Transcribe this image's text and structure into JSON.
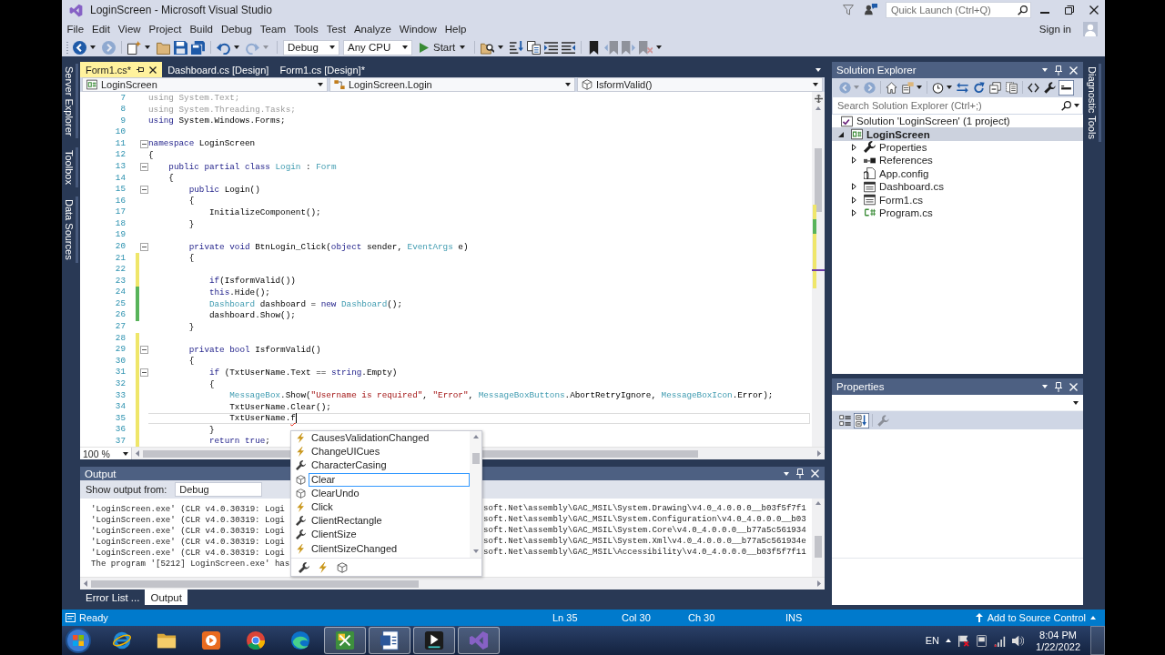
{
  "window": {
    "title": "LoginScreen - Microsoft Visual Studio",
    "quick_launch": {
      "placeholder": "Quick Launch (Ctrl+Q)"
    }
  },
  "menu": {
    "items": [
      "File",
      "Edit",
      "View",
      "Project",
      "Build",
      "Debug",
      "Team",
      "Tools",
      "Test",
      "Analyze",
      "Window",
      "Help"
    ],
    "sign_in": "Sign in"
  },
  "toolbar": {
    "left": [
      {
        "kind": "back",
        "disabled": false
      },
      {
        "kind": "forward",
        "disabled": true
      },
      {
        "kind": "new_project",
        "disabled": false
      },
      {
        "kind": "open",
        "disabled": false
      },
      {
        "kind": "save",
        "disabled": false
      },
      {
        "kind": "save_all",
        "disabled": false
      },
      {
        "kind": "undo",
        "disabled": false
      },
      {
        "kind": "redo",
        "disabled": true
      }
    ],
    "configuration": "Debug",
    "platform": "Any CPU",
    "start": "Start",
    "right": [
      {
        "kind": "find",
        "disabled": false
      },
      {
        "kind": "step",
        "disabled": false
      },
      {
        "kind": "pages",
        "disabled": false
      },
      {
        "kind": "comment",
        "disabled": false
      },
      {
        "kind": "uncomment",
        "disabled": false
      },
      {
        "kind": "bookmark",
        "disabled": false
      },
      {
        "kind": "bookmark_prev",
        "disabled": true
      },
      {
        "kind": "bookmark_next",
        "disabled": true
      },
      {
        "kind": "bookmark_clear",
        "disabled": true
      }
    ]
  },
  "side_tabs_left": [
    "Server Explorer",
    "Toolbox",
    "Data Sources"
  ],
  "document_tabs": [
    {
      "label": "Form1.cs*",
      "selected": true
    },
    {
      "label": "Dashboard.cs [Design]",
      "selected": false
    },
    {
      "label": "Form1.cs [Design]*",
      "selected": false
    }
  ],
  "navigation_bar": {
    "project": "LoginScreen",
    "type": "LoginScreen.Login",
    "member": "IsformValid()"
  },
  "editor": {
    "lines": [
      {
        "number": "7",
        "fold": false,
        "current": false,
        "tokens": [
          {
            "kind": "dim",
            "text": "using System.Text;"
          }
        ]
      },
      {
        "number": "8",
        "fold": false,
        "current": false,
        "tokens": [
          {
            "kind": "dim",
            "text": "using System.Threading.Tasks;"
          }
        ]
      },
      {
        "number": "9",
        "fold": false,
        "current": false,
        "tokens": [
          {
            "kind": "keyword",
            "text": "using"
          },
          {
            "kind": "plain",
            "text": " System.Windows.Forms;"
          }
        ]
      },
      {
        "number": "10",
        "fold": false,
        "current": false
      },
      {
        "number": "11",
        "fold": true,
        "current": false,
        "tokens": [
          {
            "kind": "keyword",
            "text": "namespace"
          },
          {
            "kind": "plain",
            "text": " LoginScreen"
          }
        ]
      },
      {
        "number": "12",
        "fold": false,
        "current": false,
        "tokens": [
          {
            "kind": "plain",
            "text": "{"
          }
        ]
      },
      {
        "number": "13",
        "fold": true,
        "current": false,
        "tokens": [
          {
            "kind": "keyword",
            "text": "    public partial class"
          },
          {
            "kind": "type",
            "text": " Login"
          },
          {
            "kind": "plain",
            "text": " : "
          },
          {
            "kind": "type",
            "text": "Form"
          }
        ]
      },
      {
        "number": "14",
        "fold": false,
        "current": false,
        "tokens": [
          {
            "kind": "plain",
            "text": "    {"
          }
        ]
      },
      {
        "number": "15",
        "fold": true,
        "current": false,
        "tokens": [
          {
            "kind": "keyword",
            "text": "        public"
          },
          {
            "kind": "plain",
            "text": " Login()"
          }
        ]
      },
      {
        "number": "16",
        "fold": false,
        "current": false,
        "tokens": [
          {
            "kind": "plain",
            "text": "        {"
          }
        ]
      },
      {
        "number": "17",
        "fold": false,
        "current": false,
        "tokens": [
          {
            "kind": "plain",
            "text": "            InitializeComponent();"
          }
        ]
      },
      {
        "number": "18",
        "fold": false,
        "current": false,
        "tokens": [
          {
            "kind": "plain",
            "text": "        }"
          }
        ]
      },
      {
        "number": "19",
        "fold": false,
        "current": false
      },
      {
        "number": "20",
        "fold": true,
        "current": false,
        "tokens": [
          {
            "kind": "keyword",
            "text": "        private void"
          },
          {
            "kind": "plain",
            "text": " BtnLogin_Click("
          },
          {
            "kind": "keyword",
            "text": "object"
          },
          {
            "kind": "plain",
            "text": " sender, "
          },
          {
            "kind": "type",
            "text": "EventArgs"
          },
          {
            "kind": "plain",
            "text": " e)"
          }
        ]
      },
      {
        "number": "21",
        "color": "#efe66a",
        "fold": false,
        "current": false,
        "tokens": [
          {
            "kind": "plain",
            "text": "        {"
          }
        ]
      },
      {
        "number": "22",
        "color": "#efe66a",
        "fold": false,
        "current": false
      },
      {
        "number": "23",
        "color": "#efe66a",
        "fold": false,
        "current": false,
        "tokens": [
          {
            "kind": "keyword",
            "text": "            if"
          },
          {
            "kind": "plain",
            "text": "(IsformValid())"
          }
        ]
      },
      {
        "number": "24",
        "color": "#58b35a",
        "fold": false,
        "current": false,
        "tokens": [
          {
            "kind": "keyword",
            "text": "            this"
          },
          {
            "kind": "plain",
            "text": ".Hide();"
          }
        ]
      },
      {
        "number": "25",
        "color": "#58b35a",
        "fold": false,
        "current": false,
        "tokens": [
          {
            "kind": "type",
            "text": "            Dashboard"
          },
          {
            "kind": "plain",
            "text": " dashboard = "
          },
          {
            "kind": "keyword",
            "text": "new"
          },
          {
            "kind": "type",
            "text": " Dashboard"
          },
          {
            "kind": "plain",
            "text": "();"
          }
        ]
      },
      {
        "number": "26",
        "color": "#58b35a",
        "fold": false,
        "current": false,
        "tokens": [
          {
            "kind": "plain",
            "text": "            dashboard.Show();"
          }
        ]
      },
      {
        "number": "27",
        "fold": false,
        "current": false,
        "tokens": [
          {
            "kind": "plain",
            "text": "        }"
          }
        ]
      },
      {
        "number": "28",
        "color": "#efe66a",
        "fold": false,
        "current": false
      },
      {
        "number": "29",
        "color": "#efe66a",
        "fold": true,
        "current": false,
        "tokens": [
          {
            "kind": "keyword",
            "text": "        private bool"
          },
          {
            "kind": "plain",
            "text": " IsformValid()"
          }
        ]
      },
      {
        "number": "30",
        "color": "#efe66a",
        "fold": false,
        "current": false,
        "tokens": [
          {
            "kind": "plain",
            "text": "        {"
          }
        ]
      },
      {
        "number": "31",
        "color": "#efe66a",
        "fold": true,
        "current": false,
        "tokens": [
          {
            "kind": "keyword",
            "text": "            if"
          },
          {
            "kind": "plain",
            "text": " (TxtUserName.Text == "
          },
          {
            "kind": "keyword",
            "text": "string"
          },
          {
            "kind": "plain",
            "text": ".Empty)"
          }
        ]
      },
      {
        "number": "32",
        "color": "#efe66a",
        "fold": false,
        "current": false,
        "tokens": [
          {
            "kind": "plain",
            "text": "            {"
          }
        ]
      },
      {
        "number": "33",
        "color": "#efe66a",
        "fold": false,
        "current": false,
        "tokens": [
          {
            "kind": "type",
            "text": "                MessageBox"
          },
          {
            "kind": "plain",
            "text": ".Show("
          },
          {
            "kind": "string",
            "text": "\"Username is required\""
          },
          {
            "kind": "plain",
            "text": ", "
          },
          {
            "kind": "string",
            "text": "\"Error\""
          },
          {
            "kind": "plain",
            "text": ", "
          },
          {
            "kind": "type",
            "text": "MessageBoxButtons"
          },
          {
            "kind": "plain",
            "text": ".AbortRetryIgnore, "
          },
          {
            "kind": "type",
            "text": "MessageBoxIcon"
          },
          {
            "kind": "plain",
            "text": ".Error);"
          }
        ]
      },
      {
        "number": "34",
        "color": "#efe66a",
        "fold": false,
        "current": false,
        "tokens": [
          {
            "kind": "plain",
            "text": "                TxtUserName.Clear();"
          }
        ]
      },
      {
        "number": "35",
        "color": "#efe66a",
        "fold": false,
        "current": true,
        "tokens": [
          {
            "kind": "plain",
            "text": "                TxtUserName."
          },
          {
            "kind": "error",
            "text": "f"
          }
        ]
      },
      {
        "number": "36",
        "color": "#efe66a",
        "fold": false,
        "current": false,
        "tokens": [
          {
            "kind": "plain",
            "text": "            }"
          }
        ]
      },
      {
        "number": "37",
        "color": "#efe66a",
        "fold": false,
        "current": false,
        "tokens": [
          {
            "kind": "keyword",
            "text": "            return true"
          },
          {
            "kind": "plain",
            "text": ";"
          }
        ]
      }
    ],
    "zoom": "100 %"
  },
  "completion_list": {
    "items": [
      {
        "kind": "event",
        "label": "CausesValidationChanged",
        "selected": false
      },
      {
        "kind": "event",
        "label": "ChangeUICues",
        "selected": false
      },
      {
        "kind": "property",
        "label": "CharacterCasing",
        "selected": false
      },
      {
        "kind": "method",
        "label": "Clear",
        "selected": true
      },
      {
        "kind": "method",
        "label": "ClearUndo",
        "selected": false
      },
      {
        "kind": "event",
        "label": "Click",
        "selected": false
      },
      {
        "kind": "property",
        "label": "ClientRectangle",
        "selected": false
      },
      {
        "kind": "property",
        "label": "ClientSize",
        "selected": false
      },
      {
        "kind": "event",
        "label": "ClientSizeChanged",
        "selected": false
      }
    ],
    "filters": [
      {
        "kind": "property"
      },
      {
        "kind": "event"
      },
      {
        "kind": "method"
      }
    ]
  },
  "output": {
    "title": "Output",
    "source_label": "Show output from:",
    "source": "Debug",
    "lines": [
      {
        "start": "'LoginScreen.exe' (CLR v4.0.30319: Logi",
        "end": "soft.Net\\assembly\\GAC_MSIL\\System.Drawing\\v4.0_4.0.0.0__b03f5f7f1"
      },
      {
        "start": "'LoginScreen.exe' (CLR v4.0.30319: Logi",
        "end": "soft.Net\\assembly\\GAC_MSIL\\System.Configuration\\v4.0_4.0.0.0__b03"
      },
      {
        "start": "'LoginScreen.exe' (CLR v4.0.30319: Logi",
        "end": "soft.Net\\assembly\\GAC_MSIL\\System.Core\\v4.0_4.0.0.0__b77a5c561934"
      },
      {
        "start": "'LoginScreen.exe' (CLR v4.0.30319: Logi",
        "end": "soft.Net\\assembly\\GAC_MSIL\\System.Xml\\v4.0_4.0.0.0__b77a5c561934e"
      },
      {
        "start": "'LoginScreen.exe' (CLR v4.0.30319: Logi",
        "end": "soft.Net\\assembly\\GAC_MSIL\\Accessibility\\v4.0_4.0.0.0__b03f5f7f11"
      },
      {
        "start": "The program '[5212] LoginScreen.exe' has"
      }
    ]
  },
  "bottom_tabs": [
    {
      "label": "Error List ...",
      "selected": false
    },
    {
      "label": "Output",
      "selected": true
    }
  ],
  "solution_explorer": {
    "title": "Solution Explorer",
    "toolbar": [
      {
        "kind": "back",
        "disabled": true,
        "pressed": false
      },
      {
        "kind": "forward",
        "disabled": true,
        "pressed": false
      },
      {
        "kind": "home",
        "disabled": false,
        "pressed": false
      },
      {
        "kind": "switch_views",
        "disabled": false,
        "pressed": false
      },
      {
        "kind": "pending_changes",
        "disabled": false,
        "pressed": false
      },
      {
        "kind": "sync",
        "disabled": false,
        "pressed": false
      },
      {
        "kind": "refresh",
        "disabled": false,
        "pressed": false
      },
      {
        "kind": "collapse_all",
        "disabled": false,
        "pressed": false
      },
      {
        "kind": "show_all_files",
        "disabled": false,
        "pressed": false
      },
      {
        "kind": "view_code",
        "disabled": false,
        "pressed": false
      },
      {
        "kind": "properties",
        "disabled": false,
        "pressed": false
      },
      {
        "kind": "preview",
        "disabled": false,
        "pressed": true
      }
    ],
    "search": {
      "placeholder": "Search Solution Explorer (Ctrl+;)"
    },
    "tree": [
      {
        "kind": "solution",
        "label": "Solution 'LoginScreen' (1 project)",
        "selected": false,
        "children": [
          {
            "kind": "project",
            "label": "LoginScreen",
            "expanded": true,
            "selected": true,
            "children": [
              {
                "kind": "properties",
                "label": "Properties",
                "expanded": false,
                "selected": false
              },
              {
                "kind": "references",
                "label": "References",
                "expanded": false,
                "selected": false
              },
              {
                "kind": "config",
                "label": "App.config",
                "selected": false
              },
              {
                "kind": "form",
                "label": "Dashboard.cs",
                "expanded": false,
                "selected": false
              },
              {
                "kind": "form",
                "label": "Form1.cs",
                "expanded": false,
                "selected": false
              },
              {
                "kind": "code",
                "label": "Program.cs",
                "expanded": false,
                "selected": false
              }
            ]
          }
        ]
      }
    ]
  },
  "properties": {
    "title": "Properties",
    "toolbar": [
      {
        "kind": "categorized",
        "disabled": false,
        "pressed": false
      },
      {
        "kind": "alphabetical",
        "disabled": false,
        "pressed": true
      },
      {
        "kind": "property_pages",
        "disabled": true,
        "pressed": false
      }
    ]
  },
  "side_tabs_right": [
    "Diagnostic Tools"
  ],
  "status_bar": {
    "status": "Ready",
    "line": "Ln 35",
    "column": "Col 30",
    "character": "Ch 30",
    "mode": "INS",
    "source_control": "Add to Source Control"
  },
  "taskbar": {
    "apps": [
      {
        "kind": "ring_browser",
        "running": false
      },
      {
        "kind": "folder",
        "running": false
      },
      {
        "kind": "player",
        "running": false
      },
      {
        "kind": "round_browser",
        "running": false
      },
      {
        "kind": "wave_browser",
        "running": false
      },
      {
        "kind": "tools",
        "running": true
      },
      {
        "kind": "document",
        "running": true
      },
      {
        "kind": "dark_app",
        "running": true
      },
      {
        "kind": "ribbon",
        "running": true
      }
    ],
    "language": "EN",
    "time": "8:04 PM",
    "date": "1/22/2022"
  }
}
